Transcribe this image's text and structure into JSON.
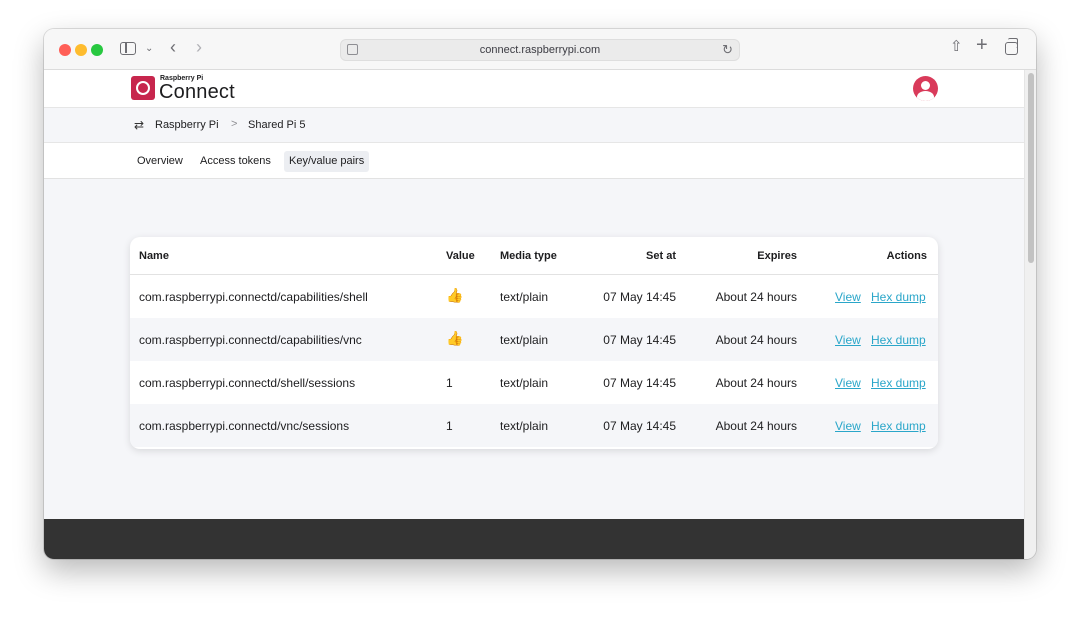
{
  "browser": {
    "url": "connect.raspberrypi.com"
  },
  "header": {
    "brand_small": "Raspberry Pi",
    "brand_big": "Connect"
  },
  "breadcrumb": {
    "items": [
      "Raspberry Pi",
      "Shared Pi 5"
    ],
    "separator": ">"
  },
  "tabs": [
    {
      "label": "Overview"
    },
    {
      "label": "Access tokens"
    },
    {
      "label": "Key/value pairs",
      "active": true
    }
  ],
  "table": {
    "columns": {
      "name": "Name",
      "value": "Value",
      "media_type": "Media type",
      "set_at": "Set at",
      "expires": "Expires",
      "actions": "Actions"
    },
    "rows": [
      {
        "name": "com.raspberrypi.connectd/capabilities/shell",
        "value": "👍",
        "media_type": "text/plain",
        "set_at": "07 May 14:45",
        "expires": "About 24 hours",
        "view": "View",
        "hex": "Hex dump"
      },
      {
        "name": "com.raspberrypi.connectd/capabilities/vnc",
        "value": "👍",
        "media_type": "text/plain",
        "set_at": "07 May 14:45",
        "expires": "About 24 hours",
        "view": "View",
        "hex": "Hex dump"
      },
      {
        "name": "com.raspberrypi.connectd/shell/sessions",
        "value": "1",
        "media_type": "text/plain",
        "set_at": "07 May 14:45",
        "expires": "About 24 hours",
        "view": "View",
        "hex": "Hex dump"
      },
      {
        "name": "com.raspberrypi.connectd/vnc/sessions",
        "value": "1",
        "media_type": "text/plain",
        "set_at": "07 May 14:45",
        "expires": "About 24 hours",
        "view": "View",
        "hex": "Hex dump"
      }
    ]
  },
  "colors": {
    "brand": "#c7264d",
    "link": "#2aa6c9",
    "footer": "#333333"
  }
}
